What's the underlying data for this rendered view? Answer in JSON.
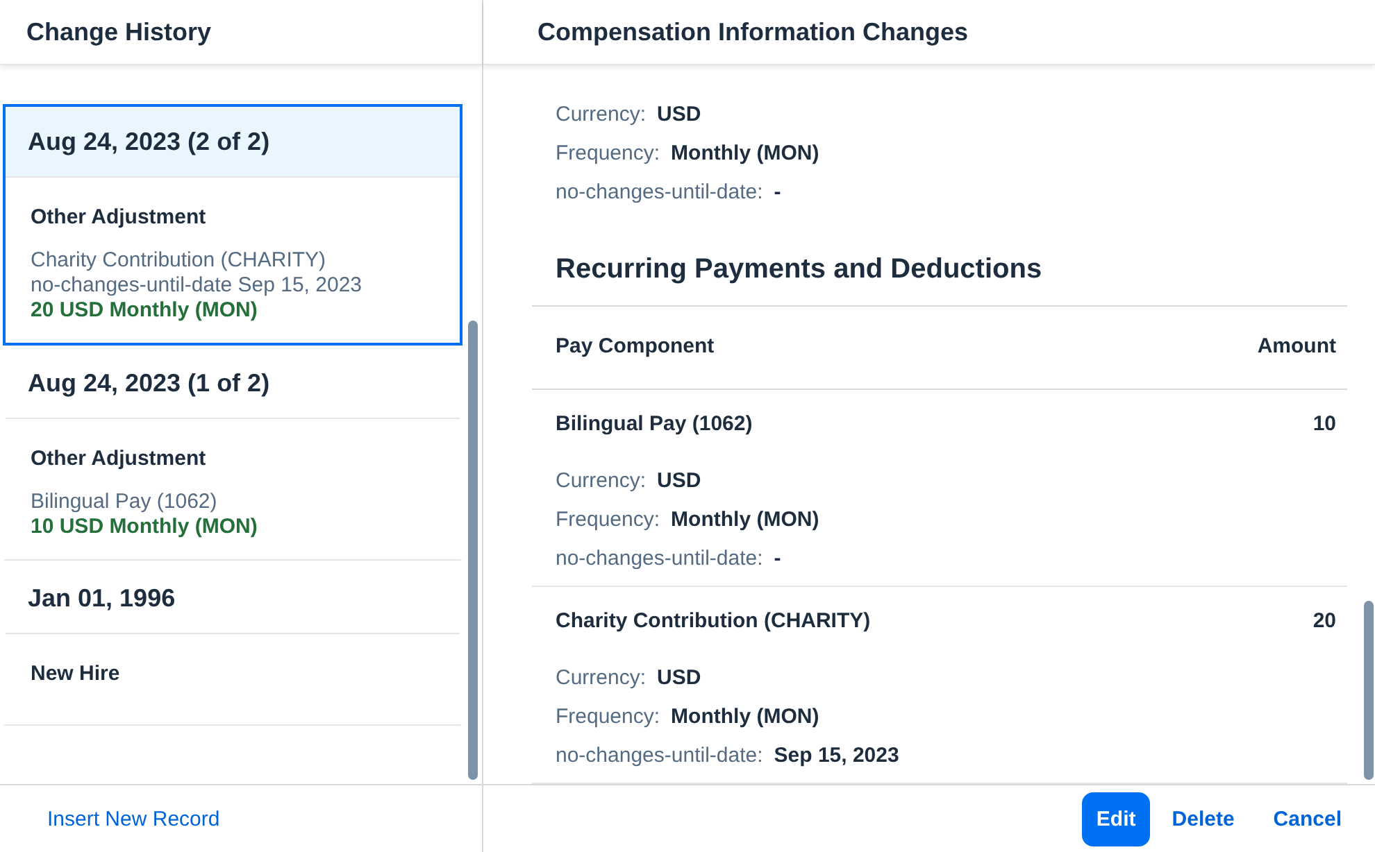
{
  "history": {
    "title": "Change History",
    "records": [
      {
        "date": "Aug 24, 2023 (2 of 2)",
        "selected": true,
        "event": "Other Adjustment",
        "lines": [
          {
            "kind": "plain",
            "text": "Charity Contribution (CHARITY)"
          },
          {
            "kind": "plain",
            "text": "no-changes-until-date Sep 15, 2023"
          },
          {
            "kind": "amount",
            "text": "20 USD Monthly (MON)"
          }
        ]
      },
      {
        "date": "Aug 24, 2023 (1 of 2)",
        "selected": false,
        "event": "Other Adjustment",
        "lines": [
          {
            "kind": "plain",
            "text": "Bilingual Pay (1062)"
          },
          {
            "kind": "amount",
            "text": "10 USD Monthly (MON)"
          }
        ]
      },
      {
        "date": "Jan 01, 1996",
        "selected": false,
        "event": "New Hire"
      }
    ],
    "footer_link": "Insert New Record"
  },
  "details": {
    "title": "Compensation Information Changes",
    "top_fields": [
      {
        "label": "Currency:",
        "value": "USD"
      },
      {
        "label": "Frequency:",
        "value": "Monthly (MON)"
      },
      {
        "label": "no-changes-until-date:",
        "value": "-"
      }
    ],
    "section_title": "Recurring Payments and Deductions",
    "table": {
      "columns": [
        "Pay Component",
        "Amount"
      ],
      "rows": [
        {
          "component": "Bilingual Pay (1062)",
          "amount": "10",
          "fields": [
            {
              "label": "Currency:",
              "value": "USD"
            },
            {
              "label": "Frequency:",
              "value": "Monthly (MON)"
            },
            {
              "label": "no-changes-until-date:",
              "value": "-"
            }
          ]
        },
        {
          "component": "Charity Contribution (CHARITY)",
          "amount": "20",
          "fields": [
            {
              "label": "Currency:",
              "value": "USD"
            },
            {
              "label": "Frequency:",
              "value": "Monthly (MON)"
            },
            {
              "label": "no-changes-until-date:",
              "value": "Sep 15, 2023"
            }
          ]
        }
      ]
    }
  },
  "buttons": [
    {
      "label": "Edit",
      "kind": "primary"
    },
    {
      "label": "Delete",
      "kind": "transparent"
    },
    {
      "label": "Cancel",
      "kind": "transparent"
    }
  ]
}
